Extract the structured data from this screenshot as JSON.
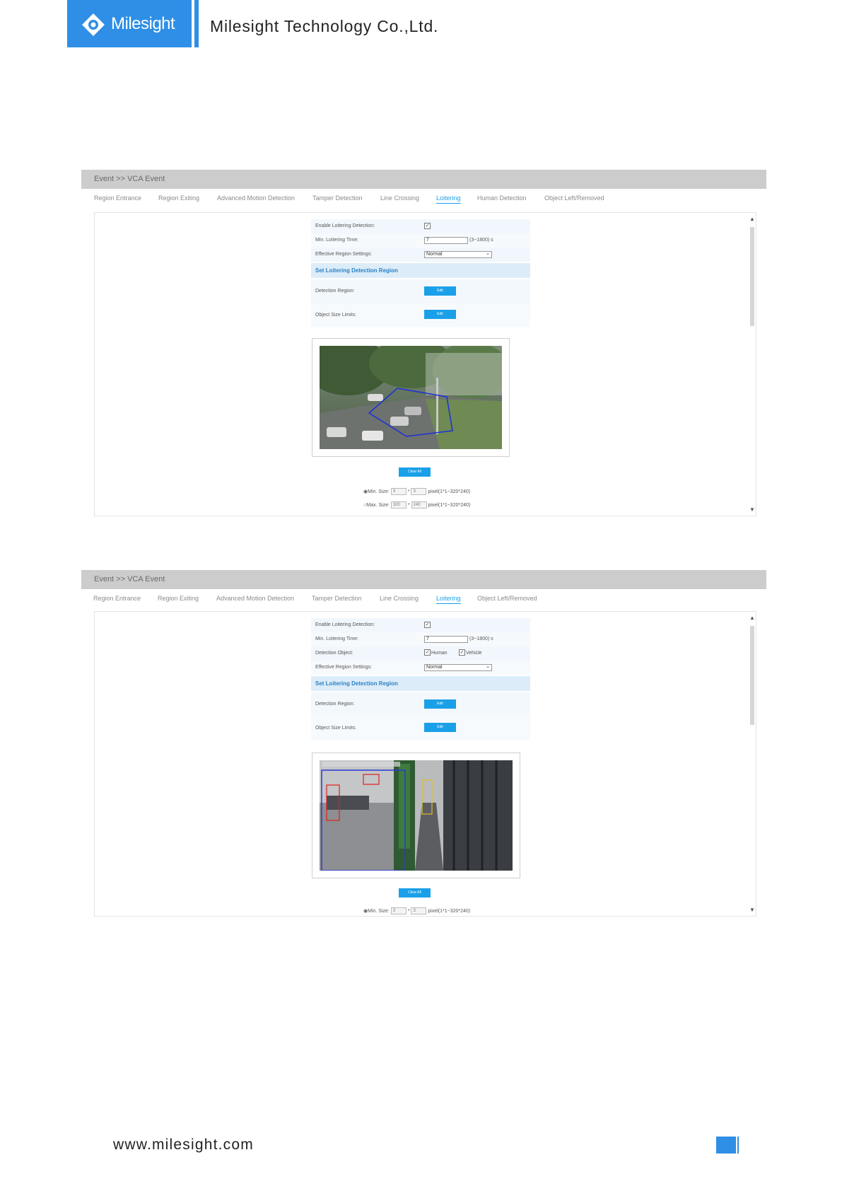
{
  "header": {
    "brand": "Milesight",
    "company": "Milesight Technology Co.,Ltd."
  },
  "footer": {
    "url": "www.milesight.com"
  },
  "colors": {
    "brand": "#2f8fe6",
    "active_tab": "#1aa0e8",
    "button": "#1aa0e8",
    "title_bar": "#cccccc"
  },
  "panel1": {
    "title": "Event >> VCA Event",
    "tabs": [
      "Region Entrance",
      "Region Exiting",
      "Advanced Motion Detection",
      "Tamper Detection",
      "Line Crossing",
      "Loitering",
      "Human Detection",
      "Object Left/Removed"
    ],
    "active_tab": "Loitering",
    "enable_label": "Enable Loitering Detection:",
    "enable_checked": true,
    "min_time_label": "Min. Loitering Time:",
    "min_time_value": "7",
    "min_time_range": "(3~1800) s",
    "region_settings_label": "Effective Region Settings:",
    "region_settings_value": "Normal",
    "section_title": "Set Loitering Detection Region",
    "detection_region_label": "Detection Region:",
    "object_size_label": "Object Size Limits:",
    "edit_label": "Edit",
    "clear_all_label": "Clear All",
    "min_size_label": "Min. Size:",
    "min_w": "3",
    "min_h": "3",
    "min_range": "pixel(1*1~320*240)",
    "max_size_label": "Max. Size:",
    "max_w": "320",
    "max_h": "240",
    "max_range": "pixel(1*1~320*240)",
    "times": "*"
  },
  "panel2": {
    "title": "Event >> VCA Event",
    "tabs": [
      "Region Entrance",
      "Region Exiting",
      "Advanced Motion Detection",
      "Tamper Detection",
      "Line Crossing",
      "Loitering",
      "Object Left/Removed"
    ],
    "active_tab": "Loitering",
    "enable_label": "Enable Loitering Detection:",
    "enable_checked": true,
    "min_time_label": "Min. Loitering Time:",
    "min_time_value": "7",
    "min_time_range": "(3~1800) s",
    "detection_object_label": "Detection Object:",
    "human_label": "Human",
    "vehicle_label": "Vehicle",
    "region_settings_label": "Effective Region Settings:",
    "region_settings_value": "Normal",
    "section_title": "Set Loitering Detection Region",
    "detection_region_label": "Detection Region:",
    "object_size_label": "Object Size Limits:",
    "edit_label": "Edit",
    "clear_all_label": "Clear All",
    "min_size_label": "Min. Size:",
    "min_w": "3",
    "min_h": "3",
    "min_range": "pixel(1*1~320*240)",
    "times": "*"
  }
}
